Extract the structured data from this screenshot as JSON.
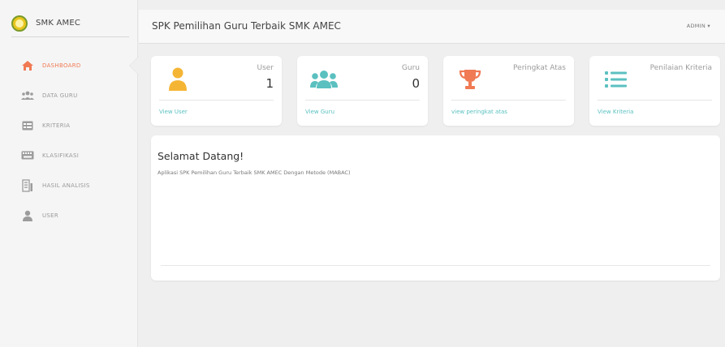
{
  "brand": {
    "name": "SMK AMEC",
    "logo_icon": "school-logo"
  },
  "header": {
    "title": "SPK Pemilihan Guru Terbaik SMK AMEC",
    "user_menu": "ADMIN ▾"
  },
  "sidebar": {
    "items": [
      {
        "label": "DASHBOARD",
        "icon": "home-icon",
        "active": true
      },
      {
        "label": "DATA GURU",
        "icon": "users-icon",
        "active": false
      },
      {
        "label": "KRITERIA",
        "icon": "table-icon",
        "active": false
      },
      {
        "label": "KLASIFIKASI",
        "icon": "keyboard-icon",
        "active": false
      },
      {
        "label": "HASIL ANALISIS",
        "icon": "report-icon",
        "active": false
      },
      {
        "label": "USER",
        "icon": "user-icon",
        "active": false
      }
    ]
  },
  "cards": [
    {
      "label": "User",
      "value": "1",
      "link": "View User",
      "icon": "user-icon",
      "color": "#f5b534"
    },
    {
      "label": "Guru",
      "value": "0",
      "link": "View Guru",
      "icon": "users-icon",
      "color": "#5bc0c0"
    },
    {
      "label": "Peringkat Atas",
      "value": "",
      "link": "view peringkat atas",
      "icon": "trophy-icon",
      "color": "#f07a54"
    },
    {
      "label": "Penilaian Kriteria",
      "value": "",
      "link": "View Kriteria",
      "icon": "list-icon",
      "color": "#5bc0c0"
    }
  ],
  "welcome": {
    "title": "Selamat Datang!",
    "text": "Aplikasi SPK Pemilihan Guru Terbaik SMK AMEC Dengan Metode (MABAC)"
  },
  "colors": {
    "accent": "#f07a54",
    "teal": "#5bc0c0",
    "yellow": "#f5b534"
  }
}
